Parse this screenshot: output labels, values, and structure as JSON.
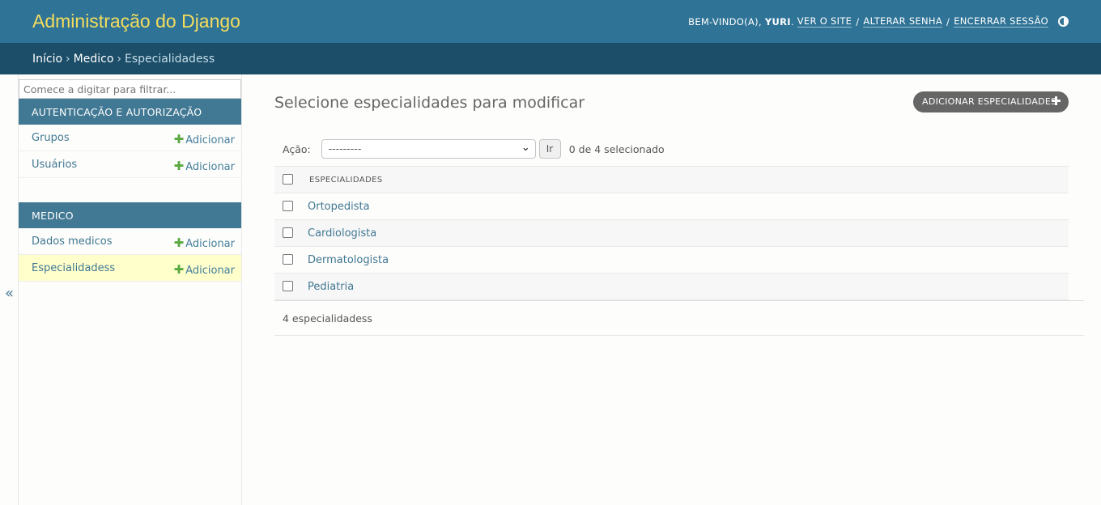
{
  "header": {
    "site_name": "Administração do Django",
    "welcome": "BEM-VINDO(A),",
    "username": "YURI",
    "view_site": "VER O SITE",
    "change_password": "ALTERAR SENHA",
    "logout": "ENCERRAR SESSÃO",
    "separator": "/"
  },
  "breadcrumbs": {
    "home": "Início",
    "app": "Medico",
    "current": "Especialidadess",
    "separator": "›"
  },
  "sidebar": {
    "collapse_glyph": "«",
    "filter_placeholder": "Comece a digitar para filtrar...",
    "modules": [
      {
        "caption": "AUTENTICAÇÃO E AUTORIZAÇÃO",
        "items": [
          {
            "label": "Grupos",
            "add": "Adicionar"
          },
          {
            "label": "Usuários",
            "add": "Adicionar"
          }
        ]
      },
      {
        "caption": "MEDICO",
        "items": [
          {
            "label": "Dados medicos",
            "add": "Adicionar"
          },
          {
            "label": "Especialidadess",
            "add": "Adicionar"
          }
        ]
      }
    ]
  },
  "content": {
    "title": "Selecione especialidades para modificar",
    "add_button": "ADICIONAR ESPECIALIDADES",
    "actions": {
      "label": "Ação:",
      "selected_value": "---------",
      "go": "Ir",
      "count": "0 de 4 selecionado"
    },
    "table": {
      "header": "ESPECIALIDADES",
      "rows": [
        "Ortopedista",
        "Cardiologista",
        "Dermatologista",
        "Pediatria"
      ]
    },
    "paginator": "4 especialidadess"
  },
  "colors": {
    "header_bg": "#2f7396",
    "breadcrumb_bg": "#1c4e69",
    "site_name": "#f5dd5d",
    "module_caption_bg": "#417893",
    "active_row_bg": "#ffffcc",
    "add_plus": "#5aa941"
  },
  "icons": {
    "theme_toggle": "half-circle-icon",
    "add": "plus-icon",
    "collapse": "double-chevron-left-icon"
  }
}
